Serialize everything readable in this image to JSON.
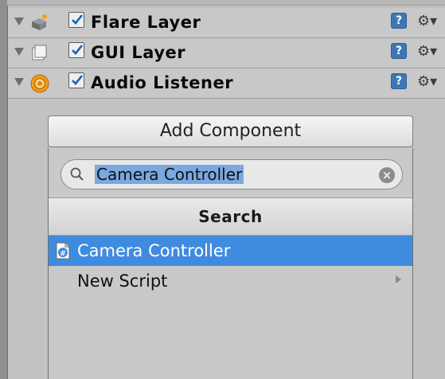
{
  "components": [
    {
      "name": "Flare Layer",
      "icon": "flare-layer-icon",
      "enabled": true
    },
    {
      "name": "GUI Layer",
      "icon": "gui-layer-icon",
      "enabled": true
    },
    {
      "name": "Audio Listener",
      "icon": "audio-listener-icon",
      "enabled": true
    }
  ],
  "help_icon_glyph": "?",
  "gear_icon_glyph": "⚙▾",
  "add_component": {
    "label": "Add Component"
  },
  "search": {
    "value": "Camera Controller",
    "placeholder": ""
  },
  "popup": {
    "header": "Search",
    "items": [
      {
        "label": "Camera Controller",
        "icon": "csharp-script-icon",
        "selected": true
      },
      {
        "label": "New Script",
        "icon": "",
        "selected": false,
        "has_submenu": true
      }
    ]
  },
  "colors": {
    "selection": "#3f8be0",
    "text_selection": "#7aa8e0",
    "help_icon": "#3d78b6"
  }
}
